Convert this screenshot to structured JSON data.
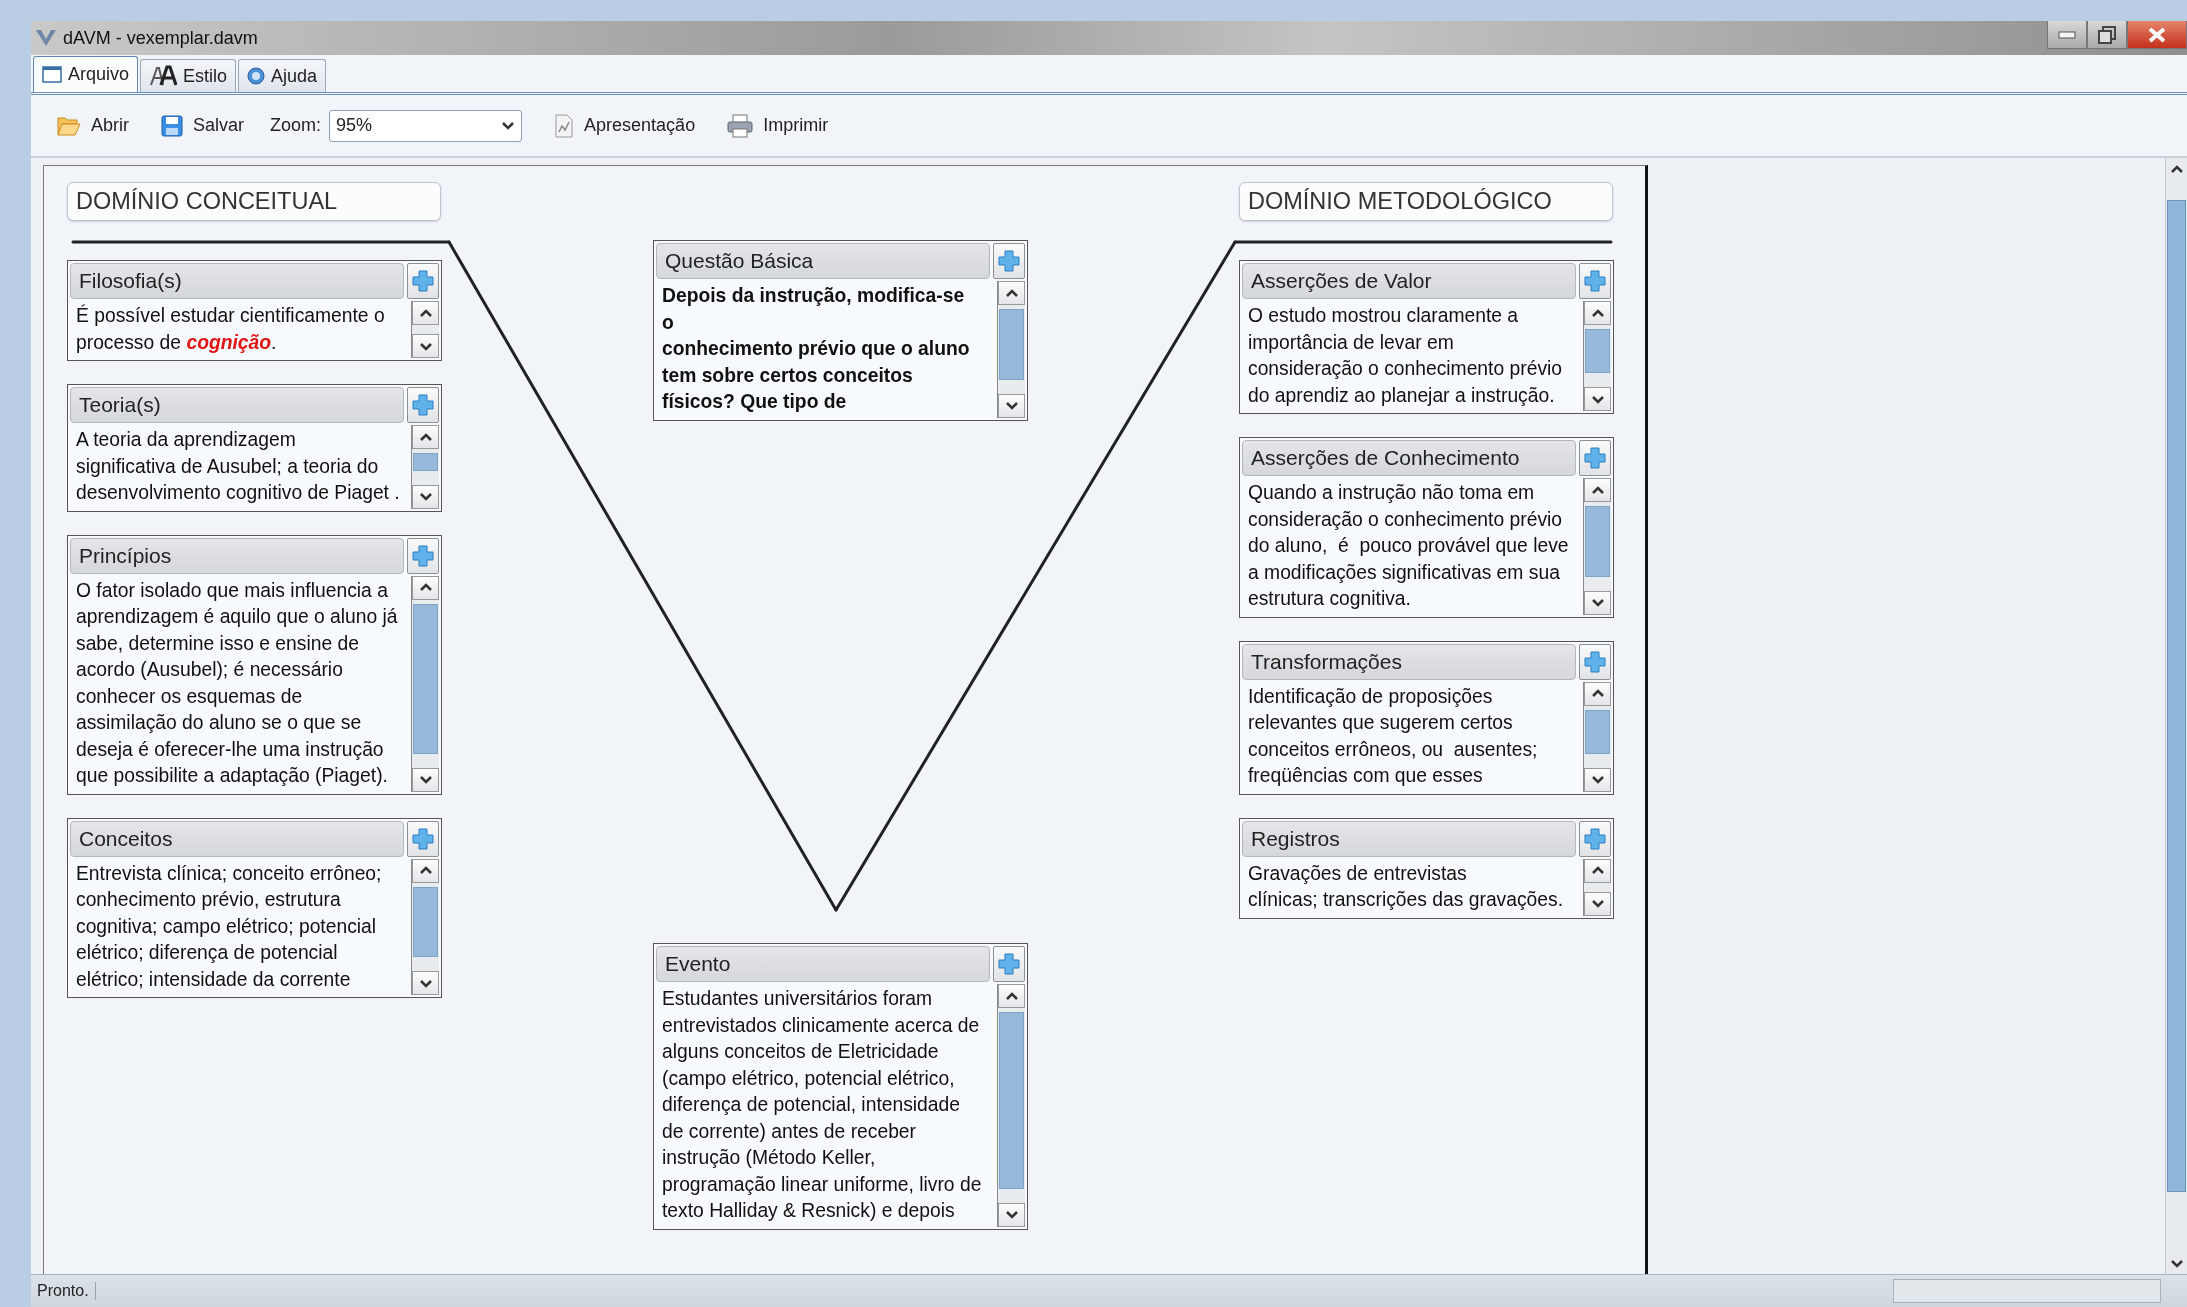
{
  "window": {
    "title": "dAVM - vexemplar.davm"
  },
  "tabs": [
    {
      "label": "Arquivo",
      "selected": true
    },
    {
      "label": "Estilo",
      "selected": false
    },
    {
      "label": "Ajuda",
      "selected": false
    }
  ],
  "toolbar": {
    "buttons": [
      {
        "kind": "open",
        "label": "Abrir"
      },
      {
        "kind": "save",
        "label": "Salvar"
      }
    ],
    "zoom_label": "Zoom:",
    "zoom_value": "95%",
    "buttons_after": [
      {
        "kind": "presentation",
        "label": "Apresentação"
      },
      {
        "kind": "print",
        "label": "Imprimir"
      }
    ]
  },
  "diagram": {
    "left_heading": "DOMÍNIO CONCEITUAL",
    "right_heading": "DOMÍNIO METODOLÓGICO",
    "left_cards": [
      {
        "title": "Filosofia(s)",
        "bold": false,
        "text": "É possível estudar cientificamente o\nprocesso de **cognição**."
      },
      {
        "title": "Teoria(s)",
        "bold": false,
        "text": "A teoria da aprendizagem\nsignificativa de Ausubel; a teoria do\ndesenvolvimento cognitivo de Piaget ."
      },
      {
        "title": "Princípios",
        "bold": false,
        "text": "O fator isolado que mais influencia a\naprendizagem é aquilo que o aluno já\nsabe, determine isso e ensine de\nacordo (Ausubel); é necessário\nconhecer os esquemas de\nassimilação do aluno se o que se\ndeseja é oferecer-lhe uma instrução\nque possibilite a adaptação (Piaget)."
      },
      {
        "title": "Conceitos",
        "bold": false,
        "text": "Entrevista clínica; conceito errôneo;\nconhecimento prévio, estrutura\ncognitiva; campo elétrico; potencial\nelétrico; diferença de potencial\nelétrico; intensidade da corrente"
      }
    ],
    "center_cards": [
      {
        "title": "Questão Básica",
        "bold": true,
        "text": "Depois da instrução, modifica-se\no\nconhecimento prévio que o aluno\ntem sobre certos conceitos\nfísicos? Que tipo de"
      },
      {
        "title": "Evento",
        "bold": false,
        "text": "Estudantes universitários foram\nentrevistados clinicamente acerca de\nalguns conceitos de Eletricidade\n(campo elétrico, potencial elétrico,\ndiferença de potencial, intensidade\nde corrente) antes de receber\ninstrução (Método Keller,\nprogramação linear uniforme, livro de\ntexto Halliday & Resnick) e depois"
      }
    ],
    "right_cards": [
      {
        "title": "Asserções de Valor",
        "bold": false,
        "text": "O estudo mostrou claramente a\nimportância de levar em\nconsideração o conhecimento prévio\ndo aprendiz ao planejar a instrução."
      },
      {
        "title": "Asserções de Conhecimento",
        "bold": false,
        "text": "Quando a instrução não toma em\nconsideração o conhecimento prévio\ndo aluno,  é  pouco provável que leve\na modificações significativas em sua\nestrutura cognitiva."
      },
      {
        "title": "Transformações",
        "bold": false,
        "text": "Identificação de proposições\nrelevantes que sugerem certos\nconceitos errôneos, ou  ausentes;\nfreqüências com que esses"
      },
      {
        "title": "Registros",
        "bold": false,
        "text": "Gravações de entrevistas\nclínicas; transcrições das gravações."
      }
    ]
  },
  "status_bar": {
    "text": "Pronto."
  }
}
